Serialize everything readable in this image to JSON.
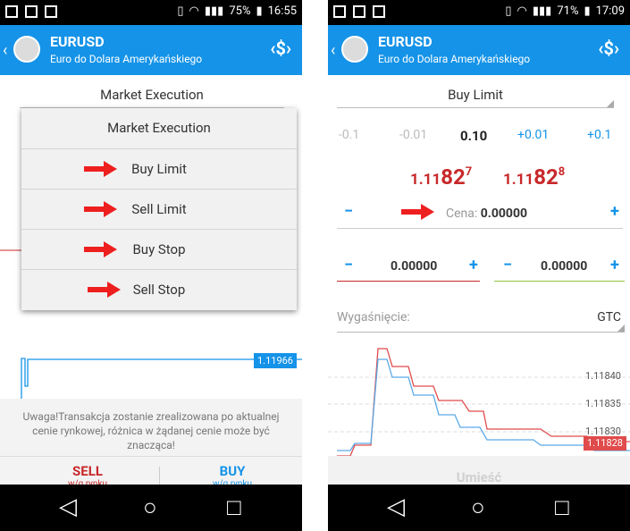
{
  "left": {
    "status": {
      "battery": "75%",
      "time": "16:55"
    },
    "appbar": {
      "symbol": "EURUSD",
      "description": "Euro do Dolara Amerykańskiego"
    },
    "order_type": "Market Execution",
    "dropdown": {
      "items": [
        "Market Execution",
        "Buy Limit",
        "Sell Limit",
        "Buy Stop",
        "Sell Stop"
      ]
    },
    "chart_price_tag": "1.11966",
    "warning": "Uwaga!Transakcja zostanie zrealizowana po aktualnej cenie rynkowej, różnica w żądanej cenie może być znacząca!",
    "sell": {
      "label": "SELL",
      "sub": "w/g rynku"
    },
    "buy": {
      "label": "BUY",
      "sub": "w/g rynku"
    }
  },
  "right": {
    "status": {
      "battery": "71%",
      "time": "17:09"
    },
    "appbar": {
      "symbol": "EURUSD",
      "description": "Euro do Dolara Amerykańskiego"
    },
    "order_type": "Buy Limit",
    "volume": {
      "values": [
        "-0.1",
        "-0.01",
        "0.10",
        "+0.01",
        "+0.1"
      ]
    },
    "bid": {
      "prefix": "1.11",
      "big": "82",
      "sup": "7"
    },
    "ask": {
      "prefix": "1.11",
      "big": "82",
      "sup": "8"
    },
    "price_field": {
      "label": "Cena:",
      "value": "0.00000"
    },
    "sl_value": "0.00000",
    "tp_value": "0.00000",
    "expiry": {
      "label": "Wygaśnięcie:",
      "value": "GTC"
    },
    "chart": {
      "levels": [
        "1.11840",
        "1.11835",
        "1.11830"
      ],
      "price_tag": "1.11828"
    },
    "submit": "Umieść"
  },
  "colors": {
    "accent": "#1593e8",
    "red": "#c8282a",
    "arrow": "#ee1f1f",
    "green": "#8fc543"
  },
  "icons": {
    "back": "back-chevron",
    "order": "currency-exchange",
    "nav": [
      "back-triangle",
      "home-circle",
      "recents-square"
    ]
  }
}
